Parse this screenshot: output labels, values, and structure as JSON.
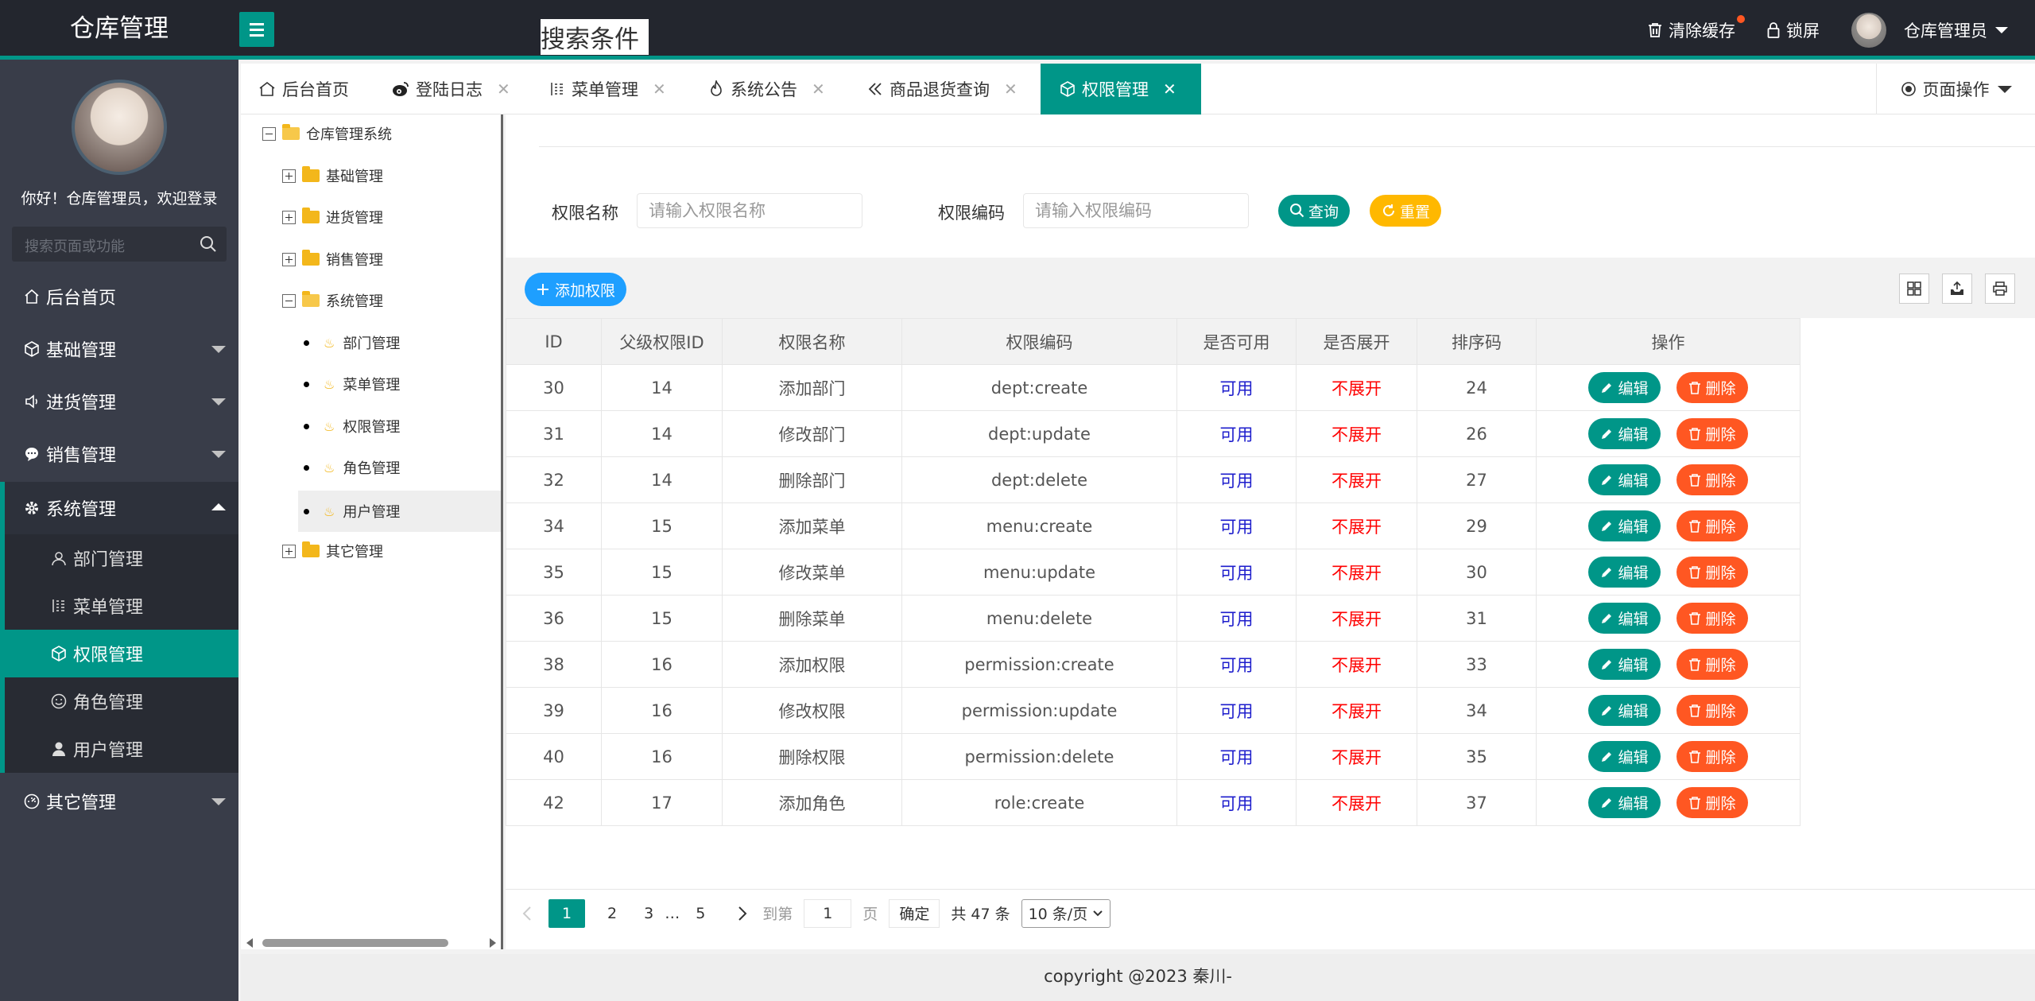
{
  "header": {
    "logo": "仓库管理",
    "clear_cache": "清除缓存",
    "lock_screen": "锁屏",
    "user_name": "仓库管理员"
  },
  "sidebar": {
    "welcome": "你好！仓库管理员，欢迎登录",
    "search_placeholder": "搜索页面或功能",
    "items": [
      {
        "label": "后台首页",
        "icon": "home-icon"
      },
      {
        "label": "基础管理",
        "icon": "cube-icon"
      },
      {
        "label": "进货管理",
        "icon": "speaker-icon"
      },
      {
        "label": "销售管理",
        "icon": "chat-icon"
      },
      {
        "label": "系统管理",
        "icon": "gear-icon"
      },
      {
        "label": "其它管理",
        "icon": "dashboard-icon"
      }
    ],
    "sub_items": [
      {
        "label": "部门管理",
        "icon": "user-outline-icon"
      },
      {
        "label": "菜单管理",
        "icon": "menu-list-icon"
      },
      {
        "label": "权限管理",
        "icon": "cube-icon"
      },
      {
        "label": "角色管理",
        "icon": "smile-icon"
      },
      {
        "label": "用户管理",
        "icon": "user-icon"
      }
    ]
  },
  "tabs": [
    {
      "label": "后台首页",
      "icon": "home-icon"
    },
    {
      "label": "登陆日志",
      "icon": "weibo-icon"
    },
    {
      "label": "菜单管理",
      "icon": "menu-list-icon"
    },
    {
      "label": "系统公告",
      "icon": "fire-icon"
    },
    {
      "label": "商品退货查询",
      "icon": "double-left-icon"
    },
    {
      "label": "权限管理",
      "icon": "cube-icon"
    }
  ],
  "page_op": "页面操作",
  "tree": {
    "root": "仓库管理系统",
    "nodes": [
      "基础管理",
      "进货管理",
      "销售管理",
      "系统管理",
      "其它管理"
    ],
    "leaves": [
      "部门管理",
      "菜单管理",
      "权限管理",
      "角色管理",
      "用户管理"
    ]
  },
  "search": {
    "legend": "搜索条件",
    "name_label": "权限名称",
    "name_placeholder": "请输入权限名称",
    "code_label": "权限编码",
    "code_placeholder": "请输入权限编码",
    "query": "查询",
    "reset": "重置"
  },
  "toolbar": {
    "add": "添加权限"
  },
  "table": {
    "columns": [
      "ID",
      "父级权限ID",
      "权限名称",
      "权限编码",
      "是否可用",
      "是否展开",
      "排序码",
      "操作"
    ],
    "edit_label": "编辑",
    "delete_label": "删除",
    "rows": [
      [
        "30",
        "14",
        "添加部门",
        "dept:create",
        "可用",
        "不展开",
        "24"
      ],
      [
        "31",
        "14",
        "修改部门",
        "dept:update",
        "可用",
        "不展开",
        "26"
      ],
      [
        "32",
        "14",
        "删除部门",
        "dept:delete",
        "可用",
        "不展开",
        "27"
      ],
      [
        "34",
        "15",
        "添加菜单",
        "menu:create",
        "可用",
        "不展开",
        "29"
      ],
      [
        "35",
        "15",
        "修改菜单",
        "menu:update",
        "可用",
        "不展开",
        "30"
      ],
      [
        "36",
        "15",
        "删除菜单",
        "menu:delete",
        "可用",
        "不展开",
        "31"
      ],
      [
        "38",
        "16",
        "添加权限",
        "permission:create",
        "可用",
        "不展开",
        "33"
      ],
      [
        "39",
        "16",
        "修改权限",
        "permission:update",
        "可用",
        "不展开",
        "34"
      ],
      [
        "40",
        "16",
        "删除权限",
        "permission:delete",
        "可用",
        "不展开",
        "35"
      ],
      [
        "42",
        "17",
        "添加角色",
        "role:create",
        "可用",
        "不展开",
        "37"
      ]
    ]
  },
  "pager": {
    "pages": [
      "1",
      "2",
      "3",
      "…",
      "5"
    ],
    "goto_label": "到第",
    "goto_value": "1",
    "page_unit": "页",
    "confirm": "确定",
    "total": "共 47 条",
    "page_size": "10 条/页"
  },
  "footer": "copyright @2023 秦川-",
  "colors": {
    "accent": "#009688",
    "danger": "#ff5722",
    "warn": "#ffb800",
    "info": "#1e9fff",
    "header": "#23262e",
    "sidebar": "#393d49"
  }
}
